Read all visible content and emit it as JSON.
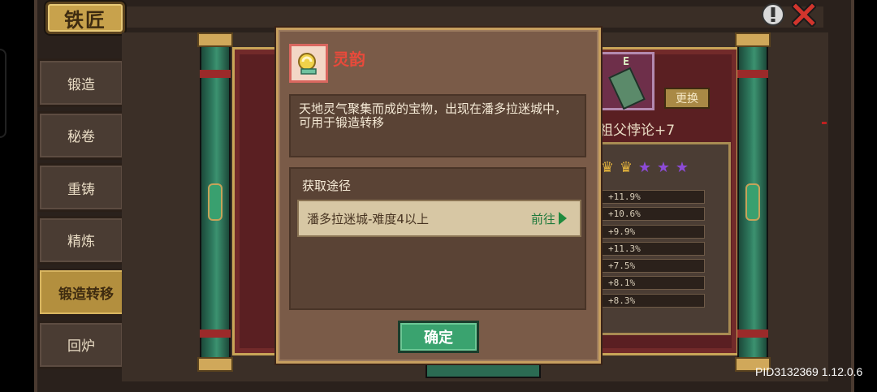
{
  "header": {
    "title": "铁匠",
    "hint_icon": "exclamation-icon",
    "close_icon": "close-icon"
  },
  "sidebar": {
    "items": [
      {
        "label": "锻造",
        "active": false
      },
      {
        "label": "秘卷",
        "active": false
      },
      {
        "label": "重铸",
        "active": false
      },
      {
        "label": "精炼",
        "active": false
      },
      {
        "label": "锻造转移",
        "active": true
      },
      {
        "label": "回炉",
        "active": false
      }
    ]
  },
  "background": {
    "item_tag": "E",
    "swap_label": "更换",
    "weapon_name": "祖父悖论+7",
    "stars": {
      "gold": 2,
      "purple": 3
    },
    "stats": [
      "+11.9%",
      "+10.6%",
      "+9.9%",
      "+11.3%",
      "+7.5%",
      "+8.1%",
      "+8.3%"
    ]
  },
  "dialog": {
    "title": "灵韵",
    "description": "天地灵气聚集而成的宝物，出现在潘多拉迷城中，可用于锻造转移",
    "source_title": "获取途径",
    "source_entry": "潘多拉迷城-难度4以上",
    "goto_label": "前往",
    "confirm_label": "确定"
  },
  "footer": {
    "pid": "PID3132369 1.12.0.6"
  },
  "colors": {
    "title_red": "#e84a3b",
    "confirm_green": "#3aa36f",
    "gold_star": "#e2b23c",
    "purple_star": "#8c4bd6"
  }
}
